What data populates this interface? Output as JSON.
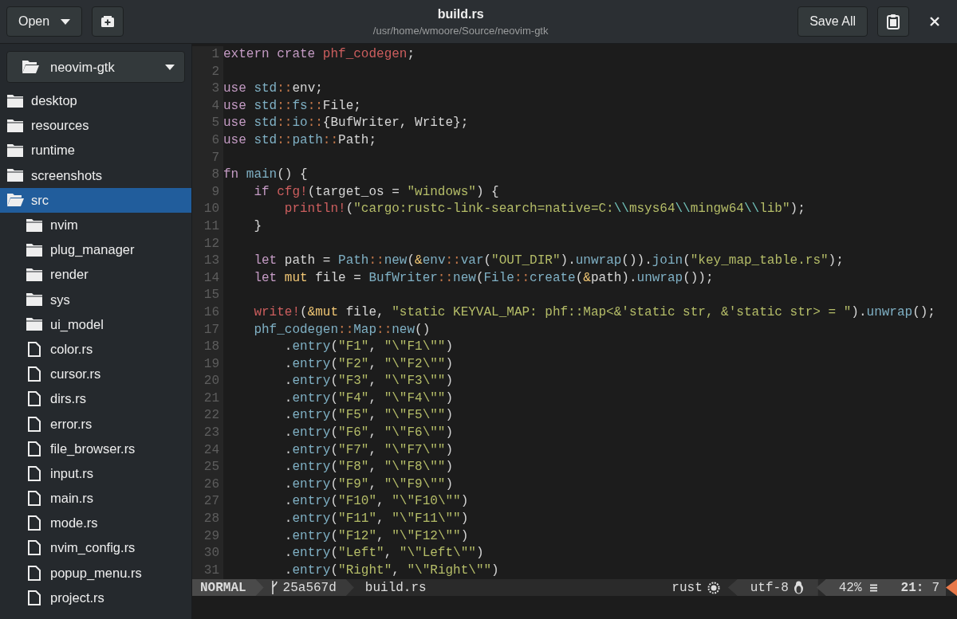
{
  "window": {
    "title": "build.rs",
    "subtitle": "/usr/home/wmoore/Source/neovim-gtk"
  },
  "header": {
    "open_button": "Open",
    "save_button": "Save All"
  },
  "sidebar": {
    "project": "neovim-gtk",
    "items": [
      {
        "label": "desktop",
        "kind": "folder",
        "expanded": false,
        "selected": false
      },
      {
        "label": "resources",
        "kind": "folder",
        "expanded": false,
        "selected": false
      },
      {
        "label": "runtime",
        "kind": "folder",
        "expanded": false,
        "selected": false
      },
      {
        "label": "screenshots",
        "kind": "folder",
        "expanded": false,
        "selected": false
      },
      {
        "label": "src",
        "kind": "folder",
        "expanded": true,
        "selected": true,
        "children": [
          {
            "label": "nvim",
            "kind": "folder",
            "expanded": false,
            "selected": false
          },
          {
            "label": "plug_manager",
            "kind": "folder",
            "expanded": false,
            "selected": false
          },
          {
            "label": "render",
            "kind": "folder",
            "expanded": false,
            "selected": false
          },
          {
            "label": "sys",
            "kind": "folder",
            "expanded": false,
            "selected": false
          },
          {
            "label": "ui_model",
            "kind": "folder",
            "expanded": false,
            "selected": false
          },
          {
            "label": "color.rs",
            "kind": "file",
            "selected": false
          },
          {
            "label": "cursor.rs",
            "kind": "file",
            "selected": false
          },
          {
            "label": "dirs.rs",
            "kind": "file",
            "selected": false
          },
          {
            "label": "error.rs",
            "kind": "file",
            "selected": false
          },
          {
            "label": "file_browser.rs",
            "kind": "file",
            "selected": false
          },
          {
            "label": "input.rs",
            "kind": "file",
            "selected": false
          },
          {
            "label": "main.rs",
            "kind": "file",
            "selected": false
          },
          {
            "label": "mode.rs",
            "kind": "file",
            "selected": false
          },
          {
            "label": "nvim_config.rs",
            "kind": "file",
            "selected": false
          },
          {
            "label": "popup_menu.rs",
            "kind": "file",
            "selected": false
          },
          {
            "label": "project.rs",
            "kind": "file",
            "selected": false
          }
        ]
      }
    ]
  },
  "editor": {
    "lines": [
      {
        "number": "1",
        "tokens": [
          {
            "kind": "kw",
            "text": "extern crate "
          },
          {
            "kind": "mac",
            "text": "phf_codegen"
          },
          {
            "kind": "plain",
            "text": ";"
          }
        ]
      },
      {
        "number": "2"
      },
      {
        "number": "3",
        "tokens": [
          {
            "kind": "kw",
            "text": "use "
          },
          {
            "kind": "ty",
            "text": "std"
          },
          {
            "kind": "sep",
            "text": "::"
          },
          {
            "kind": "plain",
            "text": "env;"
          }
        ]
      },
      {
        "number": "4",
        "tokens": [
          {
            "kind": "kw",
            "text": "use "
          },
          {
            "kind": "ty",
            "text": "std"
          },
          {
            "kind": "sep",
            "text": "::"
          },
          {
            "kind": "ty",
            "text": "fs"
          },
          {
            "kind": "sep",
            "text": "::"
          },
          {
            "kind": "plain",
            "text": "File;"
          }
        ]
      },
      {
        "number": "5",
        "tokens": [
          {
            "kind": "kw",
            "text": "use "
          },
          {
            "kind": "ty",
            "text": "std"
          },
          {
            "kind": "sep",
            "text": "::"
          },
          {
            "kind": "ty",
            "text": "io"
          },
          {
            "kind": "sep",
            "text": "::"
          },
          {
            "kind": "plain",
            "text": "{BufWriter, Write};"
          }
        ]
      },
      {
        "number": "6",
        "tokens": [
          {
            "kind": "kw",
            "text": "use "
          },
          {
            "kind": "ty",
            "text": "std"
          },
          {
            "kind": "sep",
            "text": "::"
          },
          {
            "kind": "ty",
            "text": "path"
          },
          {
            "kind": "sep",
            "text": "::"
          },
          {
            "kind": "plain",
            "text": "Path;"
          }
        ]
      },
      {
        "number": "7"
      },
      {
        "number": "8",
        "tokens": [
          {
            "kind": "kw",
            "text": "fn "
          },
          {
            "kind": "ty",
            "text": "main"
          },
          {
            "kind": "plain",
            "text": "() {"
          }
        ]
      },
      {
        "number": "9",
        "tokens": [
          {
            "kind": "kw",
            "text": "    if "
          },
          {
            "kind": "mac",
            "text": "cfg!"
          },
          {
            "kind": "plain",
            "text": "(target_os = "
          },
          {
            "kind": "str",
            "text": "\"windows\""
          },
          {
            "kind": "plain",
            "text": ") {"
          }
        ]
      },
      {
        "number": "10",
        "tokens": [
          {
            "kind": "mac",
            "text": "        println!"
          },
          {
            "kind": "plain",
            "text": "("
          },
          {
            "kind": "str",
            "text": "\"cargo:rustc-link-search=native=C:"
          },
          {
            "kind": "esc",
            "text": "\\\\"
          },
          {
            "kind": "str",
            "text": "msys64"
          },
          {
            "kind": "esc",
            "text": "\\\\"
          },
          {
            "kind": "str",
            "text": "mingw64"
          },
          {
            "kind": "esc",
            "text": "\\\\"
          },
          {
            "kind": "str",
            "text": "lib\""
          },
          {
            "kind": "plain",
            "text": ");"
          }
        ]
      },
      {
        "number": "11",
        "tokens": [
          {
            "kind": "plain",
            "text": "    }"
          }
        ]
      },
      {
        "number": "12"
      },
      {
        "number": "13",
        "tokens": [
          {
            "kind": "kw",
            "text": "    let "
          },
          {
            "kind": "plain",
            "text": "path = "
          },
          {
            "kind": "ty",
            "text": "Path"
          },
          {
            "kind": "sep",
            "text": "::"
          },
          {
            "kind": "ty",
            "text": "new"
          },
          {
            "kind": "plain",
            "text": "("
          },
          {
            "kind": "mut",
            "text": "&"
          },
          {
            "kind": "ty",
            "text": "env"
          },
          {
            "kind": "sep",
            "text": "::"
          },
          {
            "kind": "ty",
            "text": "var"
          },
          {
            "kind": "plain",
            "text": "("
          },
          {
            "kind": "str",
            "text": "\"OUT_DIR\""
          },
          {
            "kind": "plain",
            "text": ")."
          },
          {
            "kind": "ty",
            "text": "unwrap"
          },
          {
            "kind": "plain",
            "text": "())."
          },
          {
            "kind": "ty",
            "text": "join"
          },
          {
            "kind": "plain",
            "text": "("
          },
          {
            "kind": "str",
            "text": "\"key_map_table.rs\""
          },
          {
            "kind": "plain",
            "text": ");"
          }
        ]
      },
      {
        "number": "14",
        "tokens": [
          {
            "kind": "kw",
            "text": "    let "
          },
          {
            "kind": "mut",
            "text": "mut"
          },
          {
            "kind": "plain",
            "text": " file = "
          },
          {
            "kind": "ty",
            "text": "BufWriter"
          },
          {
            "kind": "sep",
            "text": "::"
          },
          {
            "kind": "ty",
            "text": "new"
          },
          {
            "kind": "plain",
            "text": "("
          },
          {
            "kind": "ty",
            "text": "File"
          },
          {
            "kind": "sep",
            "text": "::"
          },
          {
            "kind": "ty",
            "text": "create"
          },
          {
            "kind": "plain",
            "text": "("
          },
          {
            "kind": "mut",
            "text": "&"
          },
          {
            "kind": "plain",
            "text": "path)."
          },
          {
            "kind": "ty",
            "text": "unwrap"
          },
          {
            "kind": "plain",
            "text": "());"
          }
        ]
      },
      {
        "number": "15"
      },
      {
        "number": "16",
        "tokens": [
          {
            "kind": "mac",
            "text": "    write!"
          },
          {
            "kind": "plain",
            "text": "("
          },
          {
            "kind": "mut",
            "text": "&mut"
          },
          {
            "kind": "plain",
            "text": " file, "
          },
          {
            "kind": "str",
            "text": "\"static KEYVAL_MAP: phf::Map<&'static str, &'static str> = \""
          },
          {
            "kind": "plain",
            "text": ")."
          },
          {
            "kind": "ty",
            "text": "unwrap"
          },
          {
            "kind": "plain",
            "text": "();"
          }
        ]
      },
      {
        "number": "17",
        "tokens": [
          {
            "kind": "ty",
            "text": "    phf_codegen"
          },
          {
            "kind": "sep",
            "text": "::"
          },
          {
            "kind": "ty",
            "text": "Map"
          },
          {
            "kind": "sep",
            "text": "::"
          },
          {
            "kind": "ty",
            "text": "new"
          },
          {
            "kind": "plain",
            "text": "()"
          }
        ]
      },
      {
        "number": "18",
        "tokens": [
          {
            "kind": "plain",
            "text": "        ."
          },
          {
            "kind": "ty",
            "text": "entry"
          },
          {
            "kind": "plain",
            "text": "("
          },
          {
            "kind": "str",
            "text": "\"F1\""
          },
          {
            "kind": "plain",
            "text": ", "
          },
          {
            "kind": "str",
            "text": "\"\\\"F1\\\"\""
          },
          {
            "kind": "plain",
            "text": ")"
          }
        ]
      },
      {
        "number": "19",
        "tokens": [
          {
            "kind": "plain",
            "text": "        ."
          },
          {
            "kind": "ty",
            "text": "entry"
          },
          {
            "kind": "plain",
            "text": "("
          },
          {
            "kind": "str",
            "text": "\"F2\""
          },
          {
            "kind": "plain",
            "text": ", "
          },
          {
            "kind": "str",
            "text": "\"\\\"F2\\\"\""
          },
          {
            "kind": "plain",
            "text": ")"
          }
        ]
      },
      {
        "number": "20",
        "tokens": [
          {
            "kind": "plain",
            "text": "        ."
          },
          {
            "kind": "ty",
            "text": "entry"
          },
          {
            "kind": "plain",
            "text": "("
          },
          {
            "kind": "str",
            "text": "\"F3\""
          },
          {
            "kind": "plain",
            "text": ", "
          },
          {
            "kind": "str",
            "text": "\"\\\"F3\\\"\""
          },
          {
            "kind": "plain",
            "text": ")"
          }
        ]
      },
      {
        "number": "21",
        "tokens": [
          {
            "kind": "plain",
            "text": "        ."
          },
          {
            "kind": "ty",
            "text": "entry"
          },
          {
            "kind": "plain",
            "text": "("
          },
          {
            "kind": "str",
            "text": "\"F4\""
          },
          {
            "kind": "plain",
            "text": ", "
          },
          {
            "kind": "str",
            "text": "\"\\\"F4\\\"\""
          },
          {
            "kind": "plain",
            "text": ")"
          }
        ]
      },
      {
        "number": "22",
        "tokens": [
          {
            "kind": "plain",
            "text": "        ."
          },
          {
            "kind": "ty",
            "text": "entry"
          },
          {
            "kind": "plain",
            "text": "("
          },
          {
            "kind": "str",
            "text": "\"F5\""
          },
          {
            "kind": "plain",
            "text": ", "
          },
          {
            "kind": "str",
            "text": "\"\\\"F5\\\"\""
          },
          {
            "kind": "plain",
            "text": ")"
          }
        ]
      },
      {
        "number": "23",
        "tokens": [
          {
            "kind": "plain",
            "text": "        ."
          },
          {
            "kind": "ty",
            "text": "entry"
          },
          {
            "kind": "plain",
            "text": "("
          },
          {
            "kind": "str",
            "text": "\"F6\""
          },
          {
            "kind": "plain",
            "text": ", "
          },
          {
            "kind": "str",
            "text": "\"\\\"F6\\\"\""
          },
          {
            "kind": "plain",
            "text": ")"
          }
        ]
      },
      {
        "number": "24",
        "tokens": [
          {
            "kind": "plain",
            "text": "        ."
          },
          {
            "kind": "ty",
            "text": "entry"
          },
          {
            "kind": "plain",
            "text": "("
          },
          {
            "kind": "str",
            "text": "\"F7\""
          },
          {
            "kind": "plain",
            "text": ", "
          },
          {
            "kind": "str",
            "text": "\"\\\"F7\\\"\""
          },
          {
            "kind": "plain",
            "text": ")"
          }
        ]
      },
      {
        "number": "25",
        "tokens": [
          {
            "kind": "plain",
            "text": "        ."
          },
          {
            "kind": "ty",
            "text": "entry"
          },
          {
            "kind": "plain",
            "text": "("
          },
          {
            "kind": "str",
            "text": "\"F8\""
          },
          {
            "kind": "plain",
            "text": ", "
          },
          {
            "kind": "str",
            "text": "\"\\\"F8\\\"\""
          },
          {
            "kind": "plain",
            "text": ")"
          }
        ]
      },
      {
        "number": "26",
        "tokens": [
          {
            "kind": "plain",
            "text": "        ."
          },
          {
            "kind": "ty",
            "text": "entry"
          },
          {
            "kind": "plain",
            "text": "("
          },
          {
            "kind": "str",
            "text": "\"F9\""
          },
          {
            "kind": "plain",
            "text": ", "
          },
          {
            "kind": "str",
            "text": "\"\\\"F9\\\"\""
          },
          {
            "kind": "plain",
            "text": ")"
          }
        ]
      },
      {
        "number": "27",
        "tokens": [
          {
            "kind": "plain",
            "text": "        ."
          },
          {
            "kind": "ty",
            "text": "entry"
          },
          {
            "kind": "plain",
            "text": "("
          },
          {
            "kind": "str",
            "text": "\"F10\""
          },
          {
            "kind": "plain",
            "text": ", "
          },
          {
            "kind": "str",
            "text": "\"\\\"F10\\\"\""
          },
          {
            "kind": "plain",
            "text": ")"
          }
        ]
      },
      {
        "number": "28",
        "tokens": [
          {
            "kind": "plain",
            "text": "        ."
          },
          {
            "kind": "ty",
            "text": "entry"
          },
          {
            "kind": "plain",
            "text": "("
          },
          {
            "kind": "str",
            "text": "\"F11\""
          },
          {
            "kind": "plain",
            "text": ", "
          },
          {
            "kind": "str",
            "text": "\"\\\"F11\\\"\""
          },
          {
            "kind": "plain",
            "text": ")"
          }
        ]
      },
      {
        "number": "29",
        "tokens": [
          {
            "kind": "plain",
            "text": "        ."
          },
          {
            "kind": "ty",
            "text": "entry"
          },
          {
            "kind": "plain",
            "text": "("
          },
          {
            "kind": "str",
            "text": "\"F12\""
          },
          {
            "kind": "plain",
            "text": ", "
          },
          {
            "kind": "str",
            "text": "\"\\\"F12\\\"\""
          },
          {
            "kind": "plain",
            "text": ")"
          }
        ]
      },
      {
        "number": "30",
        "tokens": [
          {
            "kind": "plain",
            "text": "        ."
          },
          {
            "kind": "ty",
            "text": "entry"
          },
          {
            "kind": "plain",
            "text": "("
          },
          {
            "kind": "str",
            "text": "\"Left\""
          },
          {
            "kind": "plain",
            "text": ", "
          },
          {
            "kind": "str",
            "text": "\"\\\"Left\\\"\""
          },
          {
            "kind": "plain",
            "text": ")"
          }
        ]
      },
      {
        "number": "31",
        "tokens": [
          {
            "kind": "plain",
            "text": "        ."
          },
          {
            "kind": "ty",
            "text": "entry"
          },
          {
            "kind": "plain",
            "text": "("
          },
          {
            "kind": "str",
            "text": "\"Right\""
          },
          {
            "kind": "plain",
            "text": ", "
          },
          {
            "kind": "str",
            "text": "\"\\\"Right\\\"\""
          },
          {
            "kind": "plain",
            "text": ")"
          }
        ]
      }
    ]
  },
  "status_bar": {
    "mode": "NORMAL",
    "branch": "25a567d",
    "file": "build.rs",
    "filetype": "rust",
    "encoding": "utf-8",
    "percent": "42%",
    "position": "21:",
    "column": "7"
  }
}
